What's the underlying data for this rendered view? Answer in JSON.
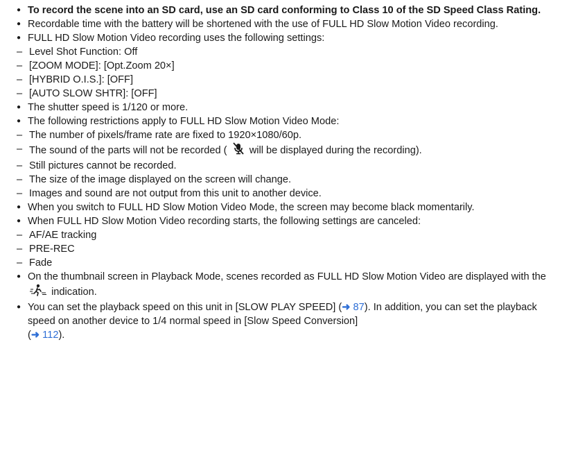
{
  "bullet_glyph": "●",
  "dash_glyph": "–",
  "items": {
    "sd_card": "To record the scene into an SD card, use an SD card conforming to Class 10 of the SD Speed Class Rating.",
    "battery": "Recordable time with the battery will be shortened with the use of FULL HD Slow Motion Video recording.",
    "settings_intro": "FULL HD Slow Motion Video recording uses the following settings:",
    "settings": [
      "Level Shot Function: Off",
      "[ZOOM MODE]: [Opt.Zoom 20×]",
      "[HYBRID O.I.S.]: [OFF]",
      "[AUTO SLOW SHTR]: [OFF]"
    ],
    "shutter": "The shutter speed is 1/120 or more.",
    "restrictions_intro": "The following restrictions apply to FULL HD Slow Motion Video Mode:",
    "restrictions": {
      "r1": "The number of pixels/frame rate are fixed to 1920×1080/60p.",
      "r2_before": "The sound of the parts will not be recorded (",
      "r2_after": "will be displayed during the recording).",
      "r3": "Still pictures cannot be recorded.",
      "r4": "The size of the image displayed on the screen will change.",
      "r5": "Images and sound are not output from this unit to another device."
    },
    "switch_mode": "When you switch to FULL HD Slow Motion Video Mode, the screen may become black momentarily.",
    "canceled_intro": "When FULL HD Slow Motion Video recording starts, the following settings are canceled:",
    "canceled": [
      "AF/AE tracking",
      "PRE-REC",
      "Fade"
    ],
    "thumbnail_before": "On the thumbnail screen in Playback Mode, scenes recorded as FULL HD Slow Motion Video are displayed with the",
    "thumbnail_after": "indication.",
    "playback": {
      "part1": "You can set the playback speed on this unit in [SLOW PLAY SPEED] (",
      "ref1": "87",
      "part2": "). In addition, you can set the playback speed on another device to 1/4 normal speed in [Slow Speed Conversion]",
      "part3_open": "(",
      "ref2": "112",
      "part3_close": ")."
    }
  },
  "arrow_glyph": "➜",
  "icons": {
    "mute": "mic-off-icon",
    "slow_motion": "slow-motion-icon"
  },
  "colors": {
    "link": "#2f6fd6",
    "text": "#1a1a1a"
  }
}
